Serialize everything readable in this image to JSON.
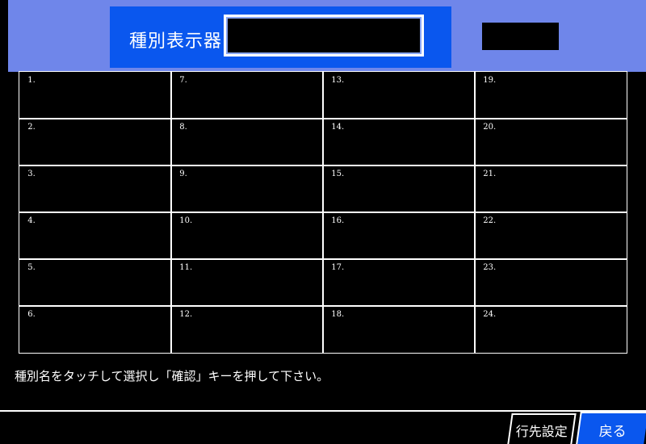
{
  "header": {
    "title_label": "種別表示器",
    "title_display_value": "",
    "side_display_value": ""
  },
  "grid": {
    "cells": [
      {
        "number": "1."
      },
      {
        "number": "2."
      },
      {
        "number": "3."
      },
      {
        "number": "4."
      },
      {
        "number": "5."
      },
      {
        "number": "6."
      },
      {
        "number": "7."
      },
      {
        "number": "8."
      },
      {
        "number": "9."
      },
      {
        "number": "10."
      },
      {
        "number": "11."
      },
      {
        "number": "12."
      },
      {
        "number": "13."
      },
      {
        "number": "14."
      },
      {
        "number": "15."
      },
      {
        "number": "16."
      },
      {
        "number": "17."
      },
      {
        "number": "18."
      },
      {
        "number": "19."
      },
      {
        "number": "20."
      },
      {
        "number": "21."
      },
      {
        "number": "22."
      },
      {
        "number": "23."
      },
      {
        "number": "24."
      }
    ]
  },
  "instruction": "種別名をタッチして選択し「確認」キーを押して下さい。",
  "tabs": {
    "route_setting_label": "行先設定",
    "back_label": "戻る"
  },
  "colors": {
    "header_bg": "#6f86ea",
    "panel_blue": "#0a57ee",
    "background": "#000000",
    "line": "#ffffff"
  }
}
